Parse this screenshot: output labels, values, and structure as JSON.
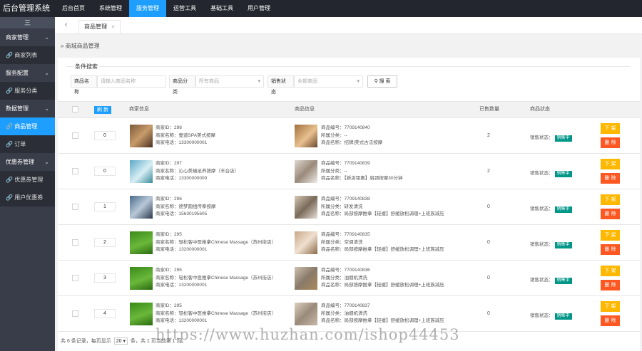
{
  "app_title": "后台管理系统",
  "top_nav": [
    "后台首页",
    "系统管理",
    "服务管理",
    "运营工具",
    "基础工具",
    "用户管理"
  ],
  "top_nav_active": 2,
  "sidebar": {
    "toggle": "三",
    "groups": [
      {
        "label": "商家管理",
        "items": [
          {
            "label": "商家列表",
            "icon": "link-icon"
          }
        ]
      },
      {
        "label": "服务配置",
        "items": [
          {
            "label": "服务分类",
            "icon": "link-icon"
          }
        ]
      },
      {
        "label": "数据管理",
        "items": [
          {
            "label": "商品管理",
            "icon": "link-icon",
            "active": true
          },
          {
            "label": "订单",
            "icon": "link-icon"
          }
        ]
      },
      {
        "label": "优惠券管理",
        "items": [
          {
            "label": "优惠券管理",
            "icon": "link-icon"
          },
          {
            "label": "用户优惠券",
            "icon": "link-icon"
          }
        ]
      }
    ]
  },
  "tabs": {
    "back": "‹",
    "current": "商品管理",
    "close": "×"
  },
  "breadcrumb": "商城商品管理",
  "filter": {
    "legend": "条件搜索",
    "name_label": "商品名称",
    "name_placeholder": "请输入商品名称",
    "category_label": "商品分类",
    "category_value": "所有商品",
    "status_label": "销售状态",
    "status_value": "全部商品",
    "search_button": "搜 索"
  },
  "table": {
    "refresh_button": "刷 新",
    "headers": {
      "merchant": "商家信息",
      "product": "商品信息",
      "sold": "已售数量",
      "status": "商品状态"
    },
    "action_down": "下 架",
    "action_delete": "删 除",
    "rows": [
      {
        "sort": "0",
        "merchant_id": "商家ID：298",
        "merchant_name": "商家名称：壹道SPA美式按摩",
        "merchant_phone": "商家电话：13300000001",
        "product_no": "商品编号：7709140840",
        "product_cat": "所属分类：--",
        "product_name": "商品名称：招牌|美式古法按摩",
        "sold": "2",
        "status_label": "销售状态：",
        "status_badge": "销售中"
      },
      {
        "sort": "0",
        "merchant_id": "商家ID：297",
        "merchant_name": "商家名称：沁心美瑞足养按摩（丰台店）",
        "merchant_phone": "商家电话：13300000000",
        "product_no": "商品编号：7709140839",
        "product_cat": "所属分类：--",
        "product_name": "商品名称：【新店钜惠】肩颈按摩30分钟",
        "sold": "2",
        "status_label": "销售状态：",
        "status_badge": "销售中"
      },
      {
        "sort": "1",
        "merchant_id": "商家ID：296",
        "merchant_name": "商家名称：德梦圆组传拳按摩",
        "merchant_phone": "商家电话：15630195605",
        "product_no": "商品编号：7709140838",
        "product_cat": "所属分类：研发清洗",
        "product_name": "商品名称：局部按摩推拿【轻缓】舒缓放松调理+上班族减压",
        "sold": "0",
        "status_label": "销售状态：",
        "status_badge": "销售中"
      },
      {
        "sort": "2",
        "merchant_id": "商家ID：295",
        "merchant_name": "商家名称：轻松客中医推拿Chinese Massage（苏州街店）",
        "merchant_phone": "商家电话：13200000001",
        "product_no": "商品编号：7709140835",
        "product_cat": "所属分类：空调清洗",
        "product_name": "商品名称：局部按摩推拿【轻缓】舒缓放松调理+上班族减压",
        "sold": "0",
        "status_label": "销售状态：",
        "status_badge": "销售中"
      },
      {
        "sort": "3",
        "merchant_id": "商家ID：295",
        "merchant_name": "商家名称：轻松客中医推拿Chinese Massage（苏州街店）",
        "merchant_phone": "商家电话：13200000001",
        "product_no": "商品编号：7709140836",
        "product_cat": "所属分类：油烟机清洗",
        "product_name": "商品名称：局部按摩推拿【轻缓】舒缓放松调理+上班族减压",
        "sold": "0",
        "status_label": "销售状态：",
        "status_badge": "销售中"
      },
      {
        "sort": "4",
        "merchant_id": "商家ID：295",
        "merchant_name": "商家名称：轻松客中医推拿Chinese Massage（苏州街店）",
        "merchant_phone": "商家电话：13200000001",
        "product_no": "商品编号：7709140837",
        "product_cat": "所属分类：油烟机清洗",
        "product_name": "商品名称：局部按摩推拿【轻缓】舒缓放松调理+上班族减压",
        "sold": "0",
        "status_label": "销售状态：",
        "status_badge": "销售中"
      }
    ]
  },
  "pager": {
    "prefix": "共 6 条记录，每页显示",
    "per_page": "20 ▾",
    "suffix": "条，共 1 页当前第 1 页"
  },
  "watermark": "https://www.huzhan.com/ishop44453",
  "colors": {
    "accent": "#1e9fff",
    "sidebar": "#393d49",
    "topbar": "#23262e",
    "badge": "#009688",
    "warn": "#ffb800",
    "danger": "#ff5722"
  }
}
